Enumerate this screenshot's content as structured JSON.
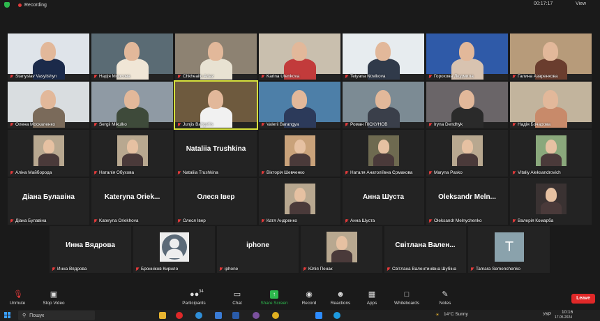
{
  "topbar": {
    "recording": "Recording",
    "timer": "00:17:17",
    "view": "View"
  },
  "participants": [
    {
      "name": "Stanyslav Vasylishyn",
      "type": "video"
    },
    {
      "name": "Надія Морсова",
      "type": "video"
    },
    {
      "name": "Chkheailo Ariaz",
      "type": "video"
    },
    {
      "name": "Karina Utenkova",
      "type": "video"
    },
    {
      "name": "Tetyana Novikova",
      "type": "video"
    },
    {
      "name": "Горохова Людмила",
      "type": "video"
    },
    {
      "name": "Галина Азаренкова",
      "type": "video"
    },
    {
      "name": "Олена Москаленко",
      "type": "video"
    },
    {
      "name": "Sergii Mikulko",
      "type": "video"
    },
    {
      "name": "Junjis Baltgstlis",
      "type": "video"
    },
    {
      "name": "Valerii Barangya",
      "type": "video"
    },
    {
      "name": "Роман ПІСКУНОВ",
      "type": "video"
    },
    {
      "name": "Iryna Dendhyk",
      "type": "video"
    },
    {
      "name": "Надія Бочарова",
      "type": "video"
    },
    {
      "name": "Аліна Майборода",
      "type": "photo"
    },
    {
      "name": "Наталія Обухова",
      "type": "photo"
    },
    {
      "name": "Nataliia Trushkina",
      "type": "text",
      "display": "Nataliia Trushkina"
    },
    {
      "name": "Вікторія Шевченко",
      "type": "photo"
    },
    {
      "name": "Наталя Анатоліївна Єрмакова",
      "type": "photo"
    },
    {
      "name": "Maryna Pasko",
      "type": "photo"
    },
    {
      "name": "Vitaliy Aleksandrovich",
      "type": "photo"
    },
    {
      "name": "Діана Булавіна",
      "type": "text",
      "display": "Діана Булавіна"
    },
    {
      "name": "Kateryna Oriekhova",
      "type": "text",
      "display": "Kateryna  Oriek..."
    },
    {
      "name": "Олеся Івер",
      "type": "text",
      "display": "Олеся Івер"
    },
    {
      "name": "Катя Андренко",
      "type": "photo"
    },
    {
      "name": "Анна Шуста",
      "type": "text",
      "display": "Анна Шуста"
    },
    {
      "name": "Oleksandr Melnychenko",
      "type": "text",
      "display": "Oleksandr  Meln..."
    },
    {
      "name": "Валерія Комарба",
      "type": "photo"
    },
    {
      "name": "Инна Вядрова",
      "type": "text",
      "display": "Инна Вядрова"
    },
    {
      "name": "Бронніков Кирило",
      "type": "avatar"
    },
    {
      "name": "iphone",
      "type": "text",
      "display": "iphone"
    },
    {
      "name": "Юлія Пенак",
      "type": "photo"
    },
    {
      "name": "Світлана Валентинівна Шубіна",
      "type": "text",
      "display": "Світлана  Вален..."
    },
    {
      "name": "Tamara Semenchenko",
      "type": "letter",
      "display": "T"
    }
  ],
  "toolbar": {
    "unmute": "Unmute",
    "stop_video": "Stop Video",
    "participants": "Participants",
    "participants_count": "34",
    "chat": "Chat",
    "share_screen": "Share Screen",
    "record": "Record",
    "reactions": "Reactions",
    "apps": "Apps",
    "whiteboards": "Whiteboards",
    "notes": "Notes",
    "leave": "Leave"
  },
  "taskbar": {
    "search": "Пошук",
    "weather": "14°C  Sunny",
    "lang": "УКР",
    "time": "10:16",
    "date": "17.05.2024"
  },
  "colors": {
    "accent_green": "#2db84d",
    "leave_red": "#e02828",
    "active_speaker": "#d6e13c"
  }
}
